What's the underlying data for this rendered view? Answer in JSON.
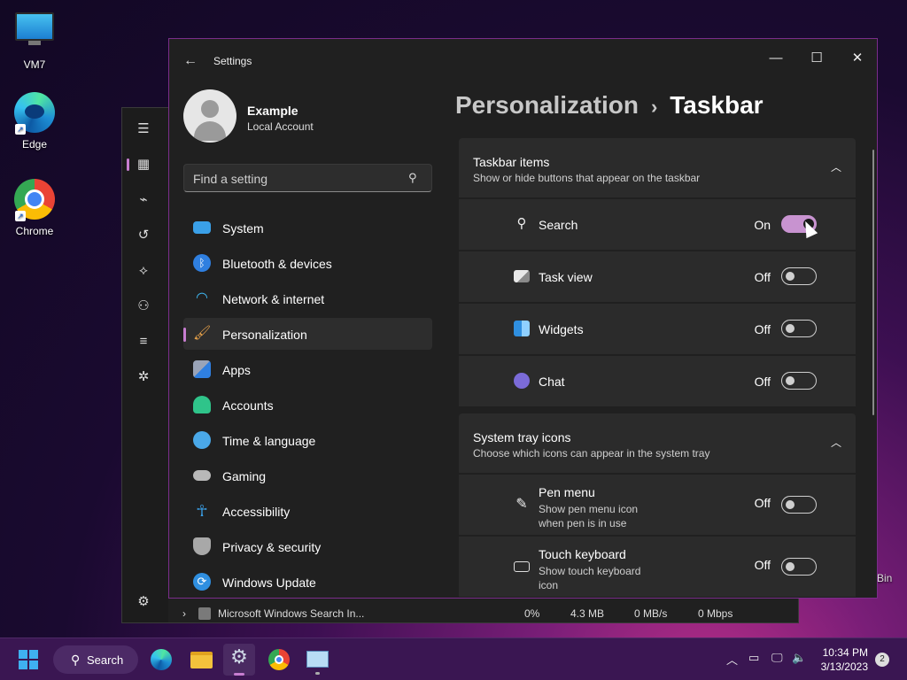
{
  "desktop": {
    "icons": [
      {
        "label": "VM7",
        "icon": "monitor-icon"
      },
      {
        "label": "Edge",
        "icon": "edge-icon"
      },
      {
        "label": "Chrome",
        "icon": "chrome-icon"
      }
    ],
    "recycle_fragment": "Bin"
  },
  "task_manager": {
    "process_row": {
      "name": "Microsoft Windows Search In...",
      "cpu": "0%",
      "memory": "4.3 MB",
      "disk": "0 MB/s",
      "network": "0 Mbps"
    }
  },
  "settings": {
    "window_title": "Settings",
    "profile": {
      "name": "Example",
      "account_type": "Local Account"
    },
    "search": {
      "placeholder": "Find a setting"
    },
    "nav": [
      {
        "label": "System",
        "icon": "system-icon",
        "color": "#3aa0e8"
      },
      {
        "label": "Bluetooth & devices",
        "icon": "bluetooth-icon",
        "color": "#2f7fe0"
      },
      {
        "label": "Network & internet",
        "icon": "wifi-icon",
        "color": "#3fb6f0"
      },
      {
        "label": "Personalization",
        "icon": "brush-icon",
        "color": "#e8a24a",
        "active": true
      },
      {
        "label": "Apps",
        "icon": "apps-icon",
        "color": "#9aa4b8"
      },
      {
        "label": "Accounts",
        "icon": "accounts-icon",
        "color": "#2fc48a"
      },
      {
        "label": "Time & language",
        "icon": "globe-clock-icon",
        "color": "#4aa8e8"
      },
      {
        "label": "Gaming",
        "icon": "gamepad-icon",
        "color": "#b8b8b8"
      },
      {
        "label": "Accessibility",
        "icon": "accessibility-icon",
        "color": "#3aa0e8"
      },
      {
        "label": "Privacy & security",
        "icon": "shield-icon",
        "color": "#a8a8a8"
      },
      {
        "label": "Windows Update",
        "icon": "update-icon",
        "color": "#2f8fe0"
      }
    ],
    "breadcrumb": {
      "parent": "Personalization",
      "separator": "›",
      "current": "Taskbar"
    },
    "sections": [
      {
        "title": "Taskbar items",
        "subtitle": "Show or hide buttons that appear on the taskbar",
        "rows": [
          {
            "label": "Search",
            "icon": "search-icon",
            "state": "On",
            "on": true
          },
          {
            "label": "Task view",
            "icon": "task-view-icon",
            "state": "Off",
            "on": false
          },
          {
            "label": "Widgets",
            "icon": "widgets-icon",
            "state": "Off",
            "on": false
          },
          {
            "label": "Chat",
            "icon": "chat-icon",
            "state": "Off",
            "on": false
          }
        ]
      },
      {
        "title": "System tray icons",
        "subtitle": "Choose which icons can appear in the system tray",
        "rows": [
          {
            "label": "Pen menu",
            "sub": "Show pen menu icon when pen is in use",
            "icon": "pen-icon",
            "state": "Off",
            "on": false
          },
          {
            "label": "Touch keyboard",
            "sub": "Show touch keyboard icon",
            "icon": "keyboard-icon",
            "state": "Off",
            "on": false
          }
        ]
      }
    ]
  },
  "taskbar": {
    "search_label": "Search",
    "time": "10:34 PM",
    "date": "3/13/2023",
    "notification_count": "2"
  }
}
